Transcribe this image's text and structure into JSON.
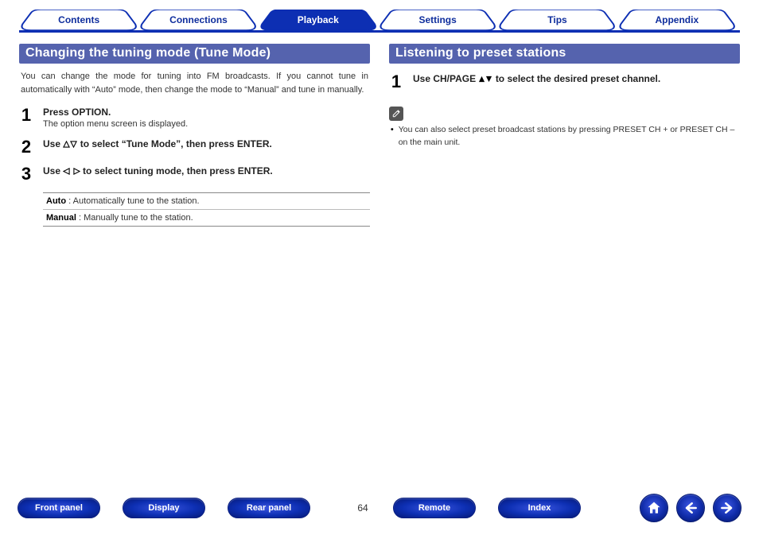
{
  "tabs": {
    "contents": "Contents",
    "connections": "Connections",
    "playback": "Playback",
    "settings": "Settings",
    "tips": "Tips",
    "appendix": "Appendix"
  },
  "left": {
    "title": "Changing the tuning mode (Tune Mode)",
    "intro": "You can change the mode for tuning into FM broadcasts. If you cannot tune in automatically with “Auto” mode, then change the mode to “Manual” and tune in manually.",
    "step1_num": "1",
    "step1_bold": "Press OPTION.",
    "step1_sub": "The option menu screen is displayed.",
    "step2_num": "2",
    "step2_a": "Use ",
    "step2_b": " to select “Tune Mode”, then press ENTER.",
    "step3_num": "3",
    "step3_a": "Use ",
    "step3_b": " to select tuning mode, then press ENTER.",
    "mode_auto_label": "Auto",
    "mode_auto_text": " : Automatically tune to the station.",
    "mode_manual_label": "Manual",
    "mode_manual_text": " : Manually tune to the station."
  },
  "right": {
    "title": "Listening to preset stations",
    "step1_num": "1",
    "step1_a": "Use CH/PAGE ",
    "step1_b": " to select the desired preset channel.",
    "note": "You can also select preset broadcast stations by pressing PRESET CH + or PRESET CH – on the main unit."
  },
  "footer": {
    "front_panel": "Front panel",
    "display": "Display",
    "rear_panel": "Rear panel",
    "page": "64",
    "remote": "Remote",
    "index": "Index"
  }
}
